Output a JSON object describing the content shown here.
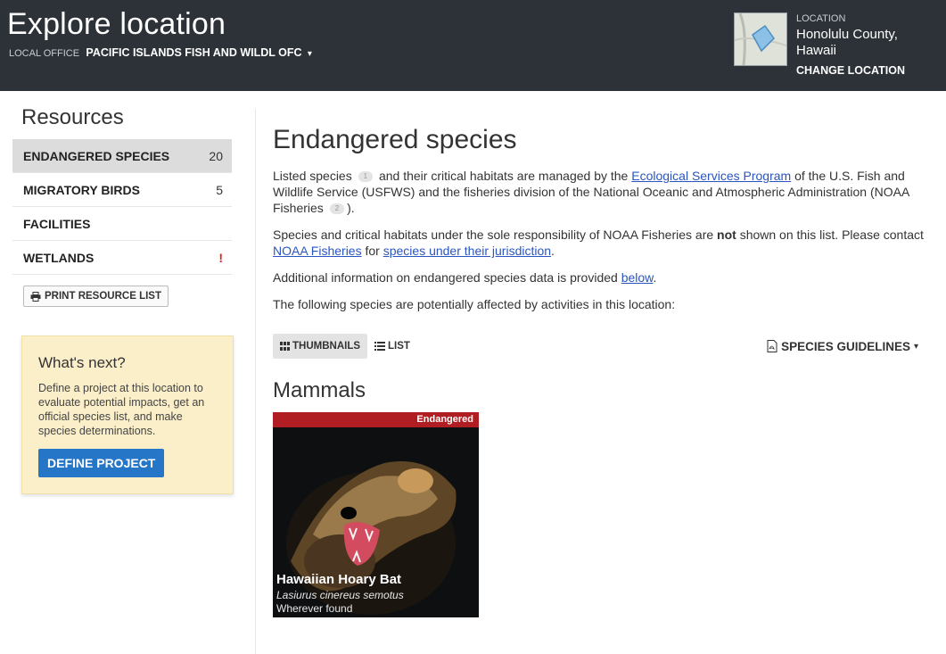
{
  "header": {
    "title": "Explore location",
    "office_label": "Local office",
    "office_name": "PACIFIC ISLANDS FISH AND WILDL OFC",
    "location_label": "LOCATION",
    "location_line1": "Honolulu County,",
    "location_line2": "Hawaii",
    "change_location": "CHANGE LOCATION"
  },
  "sidebar": {
    "title": "Resources",
    "items": [
      {
        "label": "ENDANGERED SPECIES",
        "count": "20"
      },
      {
        "label": "MIGRATORY BIRDS",
        "count": "5"
      },
      {
        "label": "FACILITIES",
        "count": ""
      },
      {
        "label": "WETLANDS",
        "count": "!"
      }
    ],
    "print_label": "PRINT RESOURCE LIST",
    "next": {
      "title": "What's next?",
      "text": "Define a project at this location to evaluate potential impacts, get an official species list, and make species determinations.",
      "button": "DEFINE PROJECT"
    }
  },
  "main": {
    "title": "Endangered species",
    "p1": {
      "a": "Listed species",
      "fn1": "1",
      "b": "and their critical habitats are managed by the",
      "link": "Ecological Services Program",
      "c": "of the U.S. Fish and Wildlife Service (USFWS) and the fisheries division of the National Oceanic and Atmospheric Administration (NOAA Fisheries",
      "fn2": "2",
      "d": ")."
    },
    "p2": {
      "a": "Species and critical habitats under the sole responsibility of NOAA Fisheries are",
      "bold": "not",
      "b": "shown on this list. Please contact",
      "link1": "NOAA Fisheries",
      "c": "for",
      "link2": "species under their jurisdiction",
      "d": "."
    },
    "p3": {
      "a": "Additional information on endangered species data is provided",
      "link": "below",
      "b": "."
    },
    "p4": "The following species are potentially affected by activities in this location:",
    "view_thumbnails": "THUMBNAILS",
    "view_list": "LIST",
    "guidelines": "SPECIES GUIDELINES",
    "group_title": "Mammals",
    "species": [
      {
        "status": "Endangered",
        "name": "Hawaiian Hoary Bat",
        "scientific": "Lasiurus cinereus semotus",
        "range": "Wherever found"
      }
    ]
  },
  "colors": {
    "header_bg": "#2c3237",
    "link": "#2a55c0",
    "primary_button": "#2576c7",
    "endangered_badge": "#b01e23",
    "next_box": "#fbefc9",
    "alert": "#e02020"
  },
  "icons": [
    "map-thumbnail-icon",
    "printer-icon",
    "grid-icon",
    "list-icon",
    "pdf-icon",
    "caret-down-icon"
  ]
}
